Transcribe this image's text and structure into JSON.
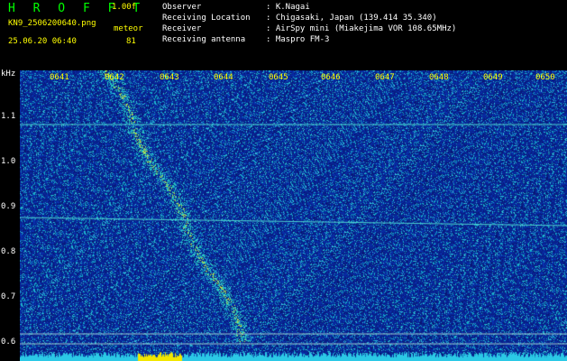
{
  "header": {
    "app_name": "H R O F F T",
    "version": "1.00f",
    "file_name": "KN9_2506200640.png",
    "meteor_label": "meteor",
    "datetime": "25.06.20 06:40",
    "meteor_count": "81",
    "info": [
      {
        "key": "Observer",
        "value": ": K.Nagai"
      },
      {
        "key": "Receiving Location",
        "value": ": Chigasaki, Japan (139.414 35.340)"
      },
      {
        "key": "Receiver",
        "value": ": AirSpy mini (Miakejima VOR 108.65MHz)"
      },
      {
        "key": "Receiving antenna",
        "value": ": Maspro FM-3"
      }
    ]
  },
  "axis": {
    "y_unit": "kHz",
    "y_ticks": [
      "1.1",
      "1.0",
      "0.9",
      "0.8",
      "0.7",
      "0.6"
    ],
    "x_ticks": [
      "0641",
      "0642",
      "0643",
      "0644",
      "0645",
      "0646",
      "0647",
      "0648",
      "0649",
      "0650"
    ]
  },
  "colors": {
    "background": "#000000",
    "spectrum_base": "#0a1f9e",
    "spectrum_hot": "#ffff00",
    "label_yellow": "#ffff00",
    "title_green": "#00ff00"
  }
}
